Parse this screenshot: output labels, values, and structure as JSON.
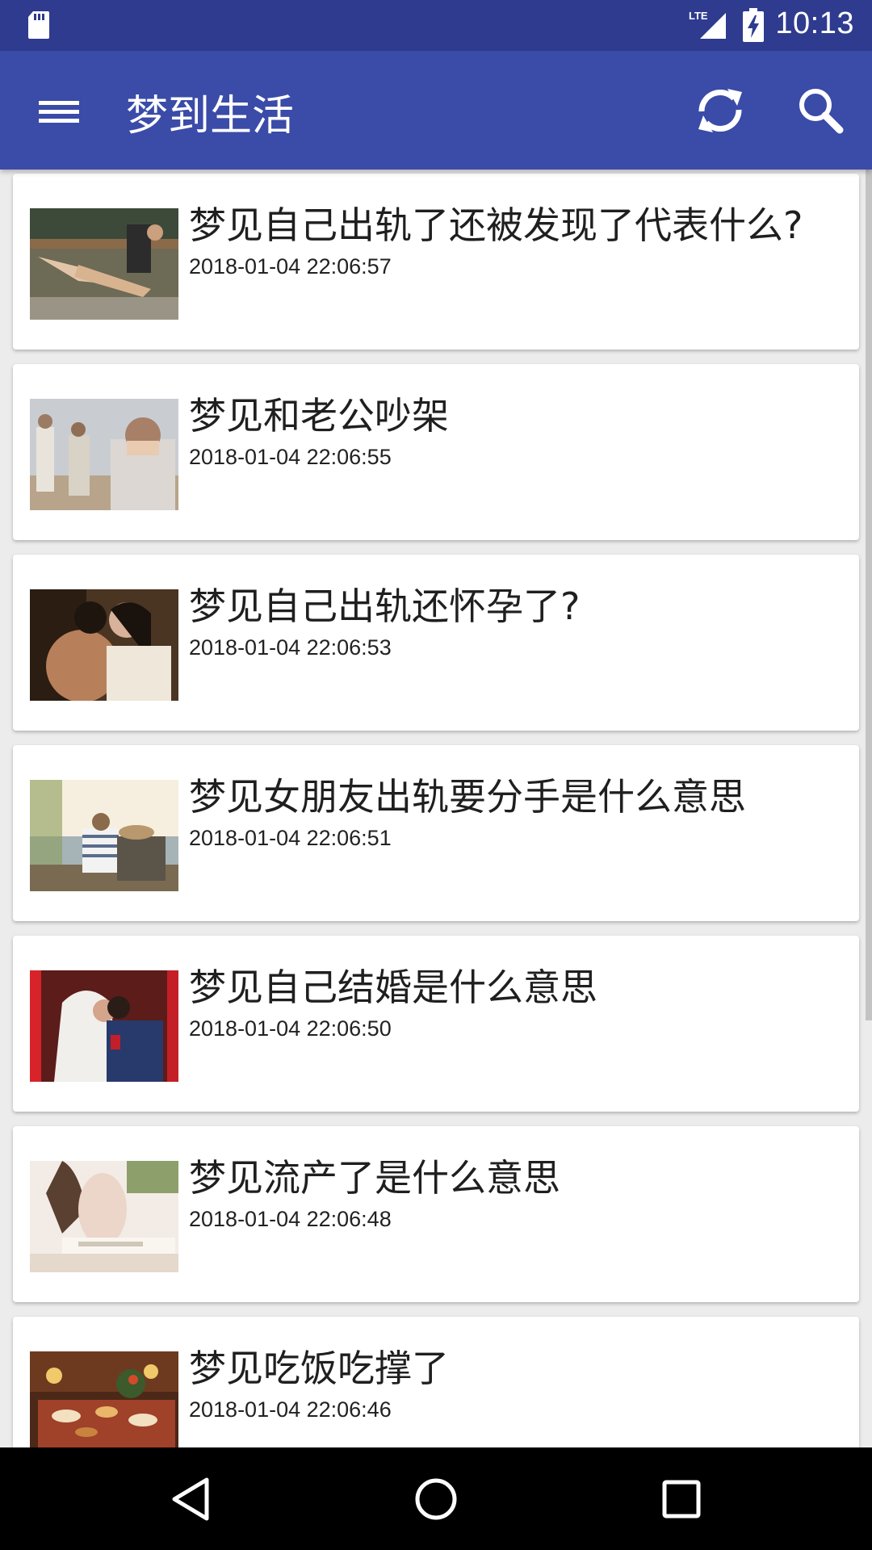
{
  "status_bar": {
    "time": "10:13",
    "network_label": "LTE",
    "icons": [
      "sd-card-icon",
      "lte-signal-icon",
      "battery-charging-icon"
    ]
  },
  "app_bar": {
    "title": "梦到生活",
    "icons": [
      "menu-icon",
      "refresh-icon",
      "search-icon"
    ],
    "color": "#3a4ba8",
    "status_color": "#2e3b8f"
  },
  "items": [
    {
      "title": "梦见自己出轨了还被发现了代表什么?",
      "time": "2018-01-04 22:06:57"
    },
    {
      "title": "梦见和老公吵架",
      "time": "2018-01-04 22:06:55"
    },
    {
      "title": "梦见自己出轨还怀孕了?",
      "time": "2018-01-04 22:06:53"
    },
    {
      "title": "梦见女朋友出轨要分手是什么意思",
      "time": "2018-01-04 22:06:51"
    },
    {
      "title": "梦见自己结婚是什么意思",
      "time": "2018-01-04 22:06:50"
    },
    {
      "title": "梦见流产了是什么意思",
      "time": "2018-01-04 22:06:48"
    },
    {
      "title": "梦见吃饭吃撑了",
      "time": "2018-01-04 22:06:46"
    }
  ],
  "nav_bar": {
    "icons": [
      "back-icon",
      "home-icon",
      "recents-icon"
    ]
  }
}
